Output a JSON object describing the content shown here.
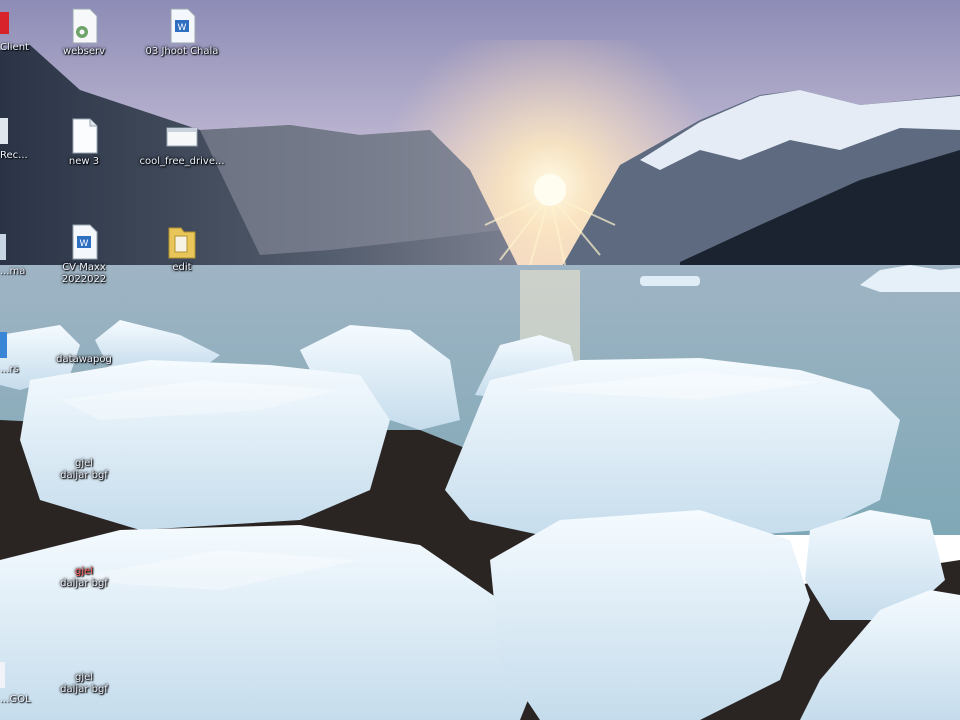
{
  "desktop": {
    "icons": [
      {
        "label": "webserv"
      },
      {
        "label": "03 Jhoot Chala"
      },
      {
        "label": "new 3"
      },
      {
        "label": "cool_free_drive..."
      },
      {
        "label": "CV Maxx",
        "label2": "2022022"
      },
      {
        "label": "edit"
      },
      {
        "label": "datawapog"
      },
      {
        "label": "gjel",
        "label2": "daljar bgf"
      },
      {
        "label": "gjel",
        "label2": "daljar bgf",
        "accent": "#ff5a5a"
      },
      {
        "label": "gjel",
        "label2": "daljar bgf"
      }
    ],
    "edge_labels": [
      "Client",
      "Rec...",
      "...ma",
      "...rs",
      "...GOL"
    ]
  },
  "colors": {
    "sky_top": "#8e8db6",
    "sky_horizon": "#f3d6c0",
    "sun": "#fff6d8",
    "water": "#8fb0bd",
    "ice": "#e8f2fa",
    "rocks": "#2a2523",
    "icon_label": "#eef4ff"
  }
}
